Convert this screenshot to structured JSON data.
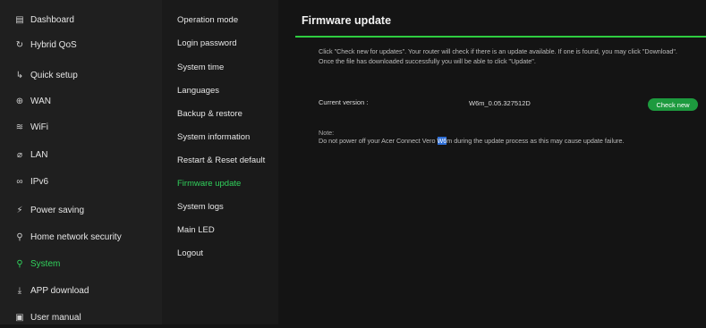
{
  "nav": {
    "items": [
      {
        "label": "Dashboard",
        "icon": "▤"
      },
      {
        "label": "Hybrid QoS",
        "icon": "↻"
      },
      {
        "label": "Quick setup",
        "icon": "↳"
      },
      {
        "label": "WAN",
        "icon": "⊕"
      },
      {
        "label": "WiFi",
        "icon": "≋"
      },
      {
        "label": "LAN",
        "icon": "⌀"
      },
      {
        "label": "IPv6",
        "icon": "∞"
      },
      {
        "label": "Power saving",
        "icon": "⚡"
      },
      {
        "label": "Home network security",
        "icon": "⚲"
      },
      {
        "label": "System",
        "icon": "⚲"
      },
      {
        "label": "APP download",
        "icon": "⤓"
      },
      {
        "label": "User manual",
        "icon": "▣"
      }
    ]
  },
  "sub": {
    "items": [
      "Operation mode",
      "Login password",
      "System time",
      "Languages",
      "Backup & restore",
      "System information",
      "Restart & Reset default",
      "Firmware update",
      "System logs",
      "Main LED",
      "Logout"
    ]
  },
  "main": {
    "title": "Firmware update",
    "description": "Click \"Check new for updates\". Your router will check if there is an update available. If one is found, you may click \"Download\". Once the file has downloaded successfully you will be able to click \"Update\".",
    "current_version_label": "Current version :",
    "current_version_value": "W6m_0.05.327512D",
    "check_button": "Check new",
    "note_label": "Note:",
    "note_before": "Do not power off your Acer Connect Vero ",
    "note_highlight": "W6",
    "note_after": "m during the update process as this may cause update failure."
  },
  "colors": {
    "accent": "#31d25c",
    "button": "#1d9a3e",
    "rule": "#2ecc40",
    "selection": "#2f6fd6"
  }
}
